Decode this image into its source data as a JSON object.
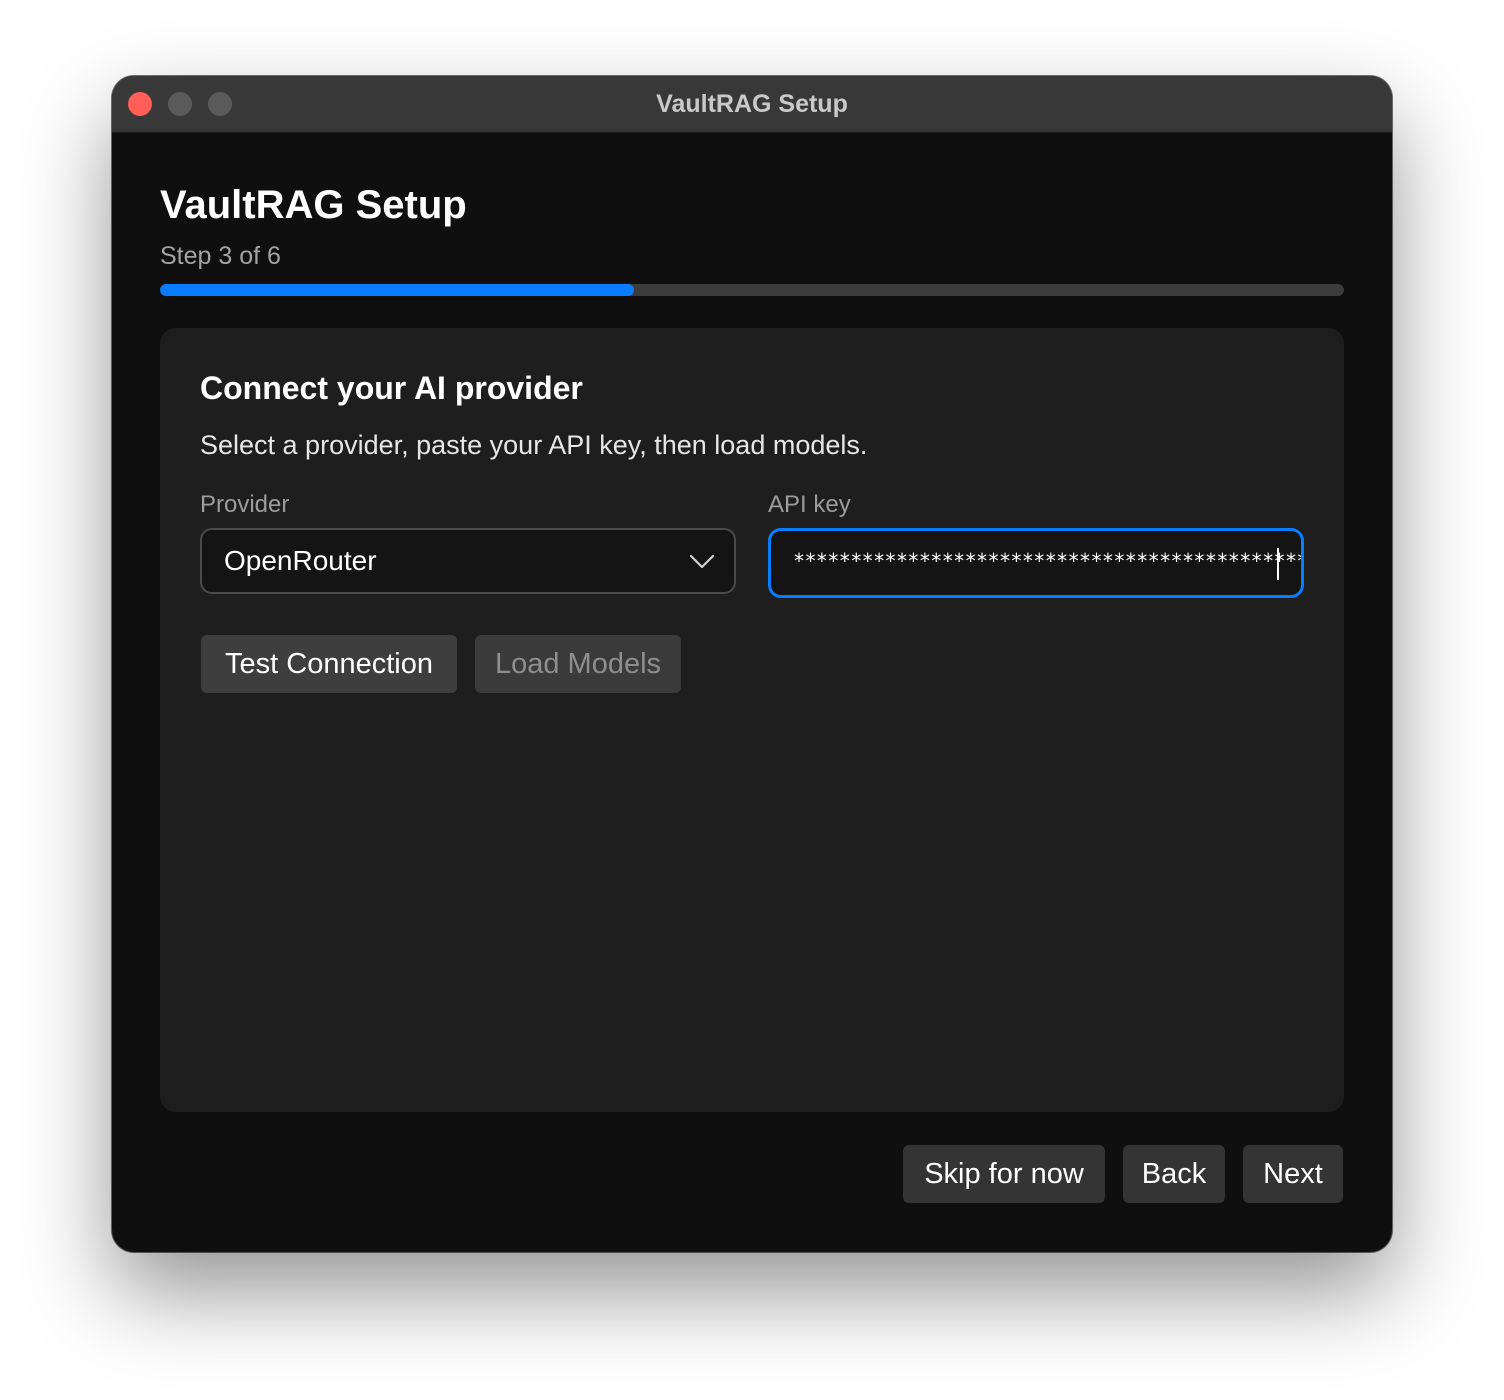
{
  "window": {
    "title": "VaultRAG Setup"
  },
  "header": {
    "heading": "VaultRAG Setup",
    "step_label": "Step 3 of 6",
    "progress": 0.4
  },
  "card": {
    "title": "Connect your AI provider",
    "subtitle": "Select a provider, paste your API key, then load models.",
    "provider": {
      "label": "Provider",
      "selected": "OpenRouter"
    },
    "api_key": {
      "label": "API key",
      "masked_value": "*********************************************"
    },
    "buttons": {
      "test_connection": "Test Connection",
      "load_models": "Load Models"
    }
  },
  "footer": {
    "skip_label": "Skip for now",
    "back_label": "Back",
    "next_label": "Next"
  },
  "colors": {
    "accent": "#0a7cff",
    "window_bg": "#0f0f0f",
    "card_bg": "#1e1e1e",
    "close_button": "#fe5f57"
  },
  "icons": {
    "dropdown": "chevron-down-icon"
  }
}
